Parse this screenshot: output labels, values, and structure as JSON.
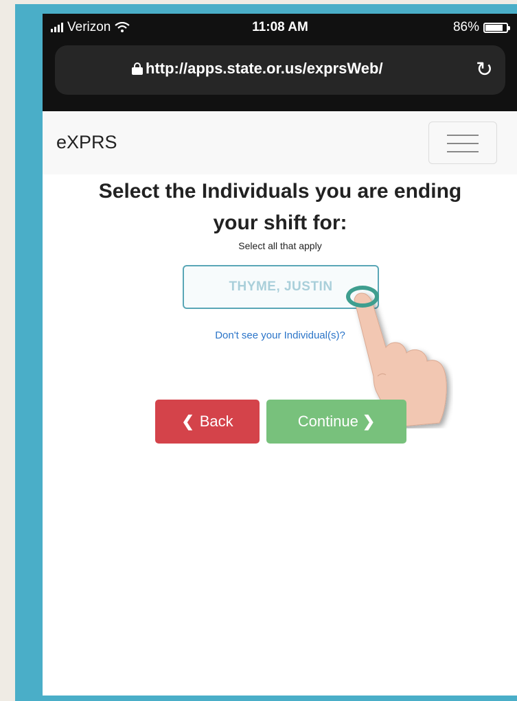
{
  "status_bar": {
    "carrier": "Verizon",
    "time": "11:08 AM",
    "battery": "86%",
    "battery_level": 0.86
  },
  "browser": {
    "url": "http://apps.state.or.us/exprsWeb/",
    "lock_icon": "lock-icon",
    "reload_icon": "reload-icon"
  },
  "app": {
    "brand": "eXPRS",
    "menu_icon": "hamburger-menu-icon"
  },
  "page": {
    "heading_line1": "Select the Individuals you are ending",
    "heading_line2": "your shift for:",
    "subtext": "Select all that apply",
    "individual": "THYME, JUSTIN",
    "missing_link": "Don't see your Individual(s)?"
  },
  "actions": {
    "back_label": "Back",
    "continue_label": "Continue"
  },
  "colors": {
    "frame": "#4aaec8",
    "back": "#d4434a",
    "continue": "#78c17c",
    "link": "#2a74c8"
  }
}
